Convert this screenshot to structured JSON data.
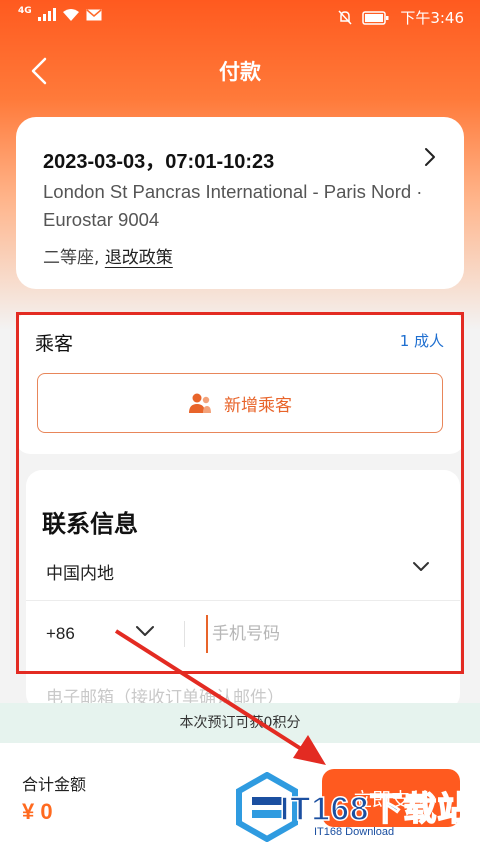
{
  "status_bar": {
    "network": "4G",
    "time": "下午3:46"
  },
  "header": {
    "title": "付款",
    "back_icon": "chevron-left-icon"
  },
  "trip": {
    "datetime": "2023-03-03，07:01-10:23",
    "route": "London St Pancras International - Paris Nord · Eurostar 9004",
    "seat_class": "二等座,",
    "policy_link": "退改政策"
  },
  "passengers": {
    "title": "乘客",
    "count": "1 成人",
    "add_button": "新增乘客"
  },
  "contact": {
    "title": "联系信息",
    "region": "中国内地",
    "phone_code": "+86",
    "phone_placeholder": "手机号码",
    "email_placeholder": "电子邮箱（接收订单确认邮件）"
  },
  "points_banner": "本次预订可获0积分",
  "footer": {
    "total_label": "合计金额",
    "total_amount": "¥ 0",
    "pay_button": "立即支付"
  },
  "watermark": {
    "text": "IT168下载站",
    "subtext": "IT168 Download"
  },
  "colors": {
    "brand": "#ff5a1f",
    "link": "#1f6fd0",
    "annotation": "#e32b22"
  }
}
